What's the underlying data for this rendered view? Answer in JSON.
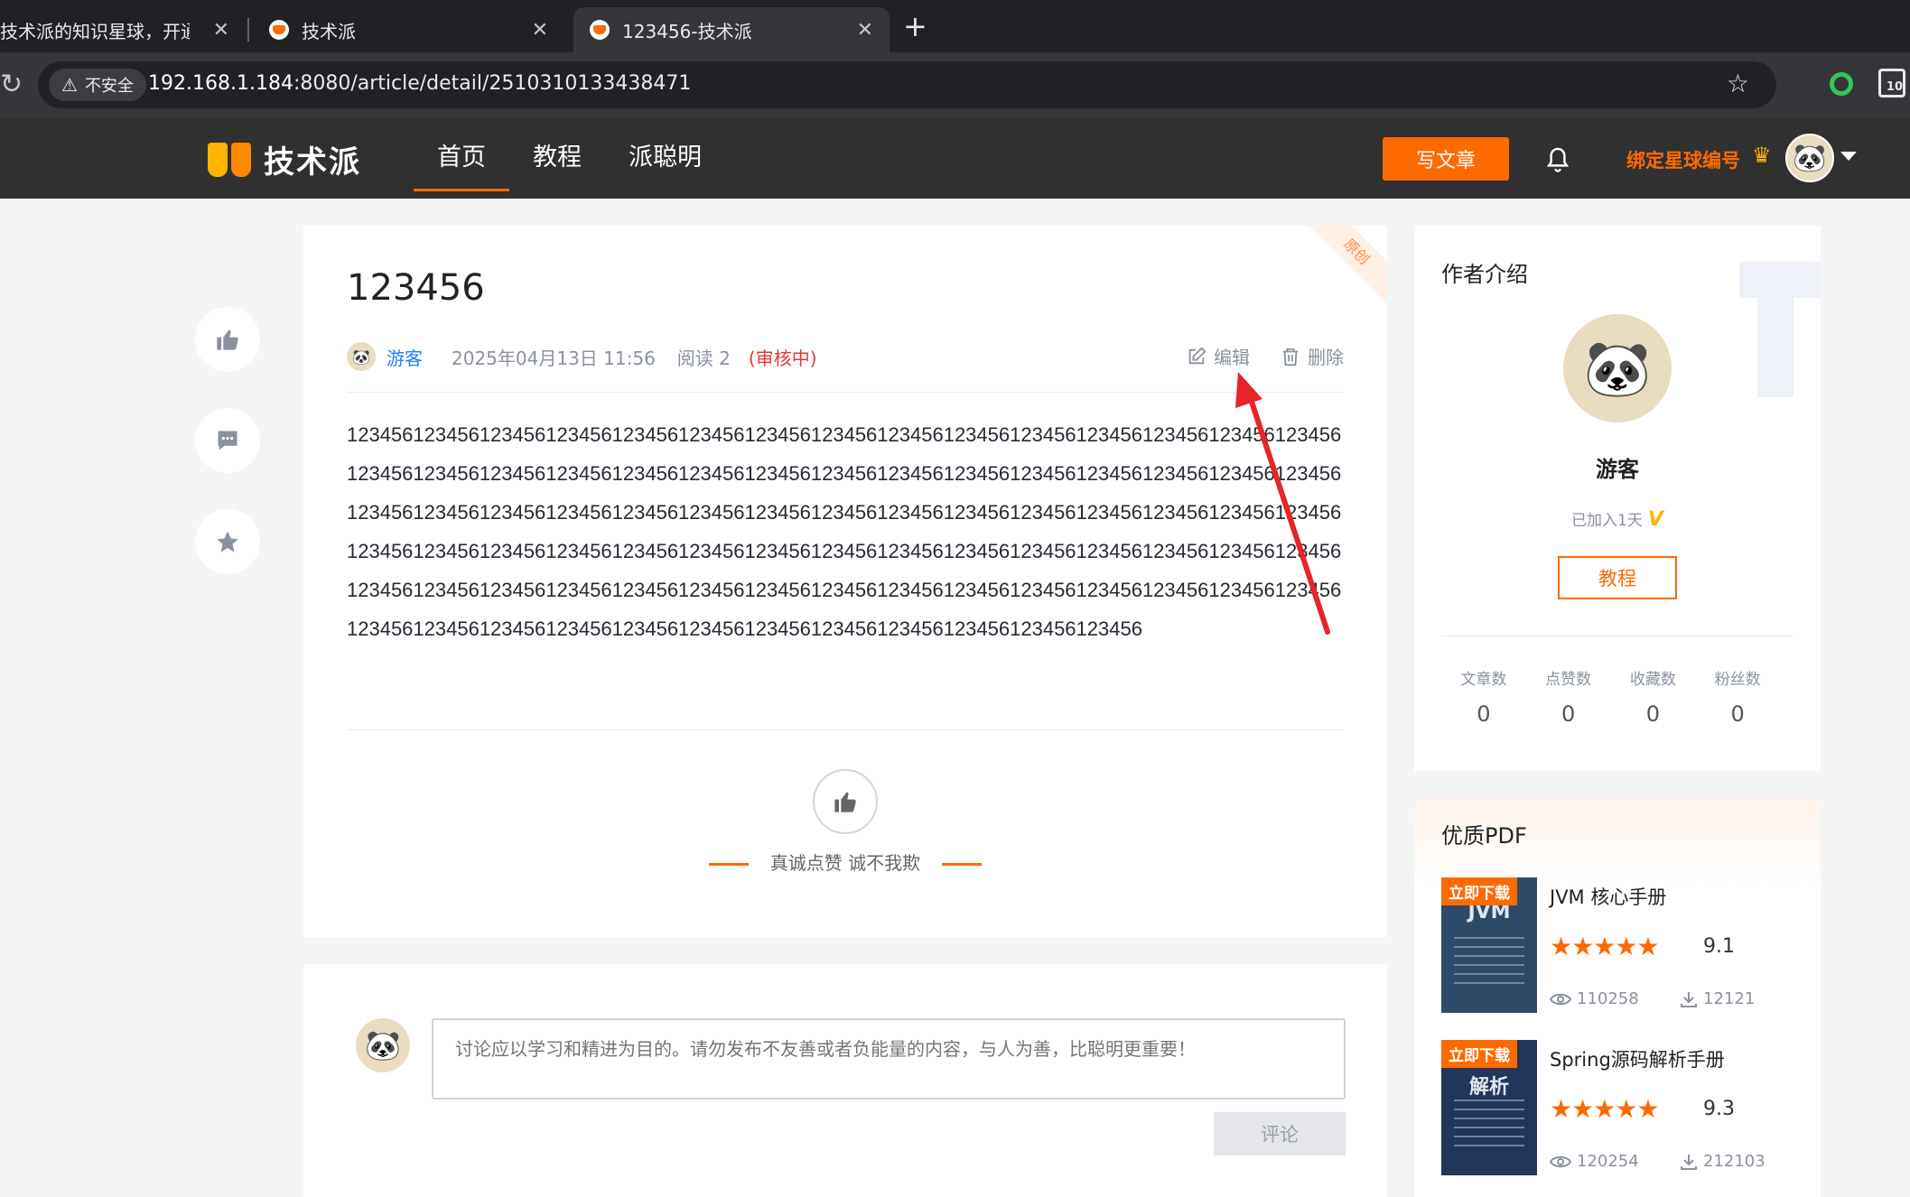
{
  "browser": {
    "tabs": [
      {
        "title": "技术派的知识星球，开通啦！附"
      },
      {
        "title": "技术派"
      },
      {
        "title": "123456-技术派"
      }
    ],
    "security_label": "不安全",
    "url_host": "192.168.1.184",
    "url_rest": ":8080/article/detail/2510310133438471",
    "ext_badge": "10"
  },
  "site": {
    "logo_text": "技术派",
    "nav": [
      "首页",
      "教程",
      "派聪明"
    ],
    "write_button": "写文章",
    "bind_label": "绑定星球编号"
  },
  "article": {
    "ribbon": "原创",
    "title": "123456",
    "author": "游客",
    "date": "2025年04月13日 11:56",
    "reads": "阅读 2",
    "status": "(审核中)",
    "edit_label": "编辑",
    "delete_label": "删除",
    "body": "123456123456123456123456123456123456123456123456123456123456123456123456123456123456123456123456123456123456123456123456123456123456123456123456123456123456123456123456123456123456123456123456123456123456123456123456123456123456123456123456123456123456123456123456123456123456123456123456123456123456123456123456123456123456123456123456123456123456123456123456123456123456123456123456123456123456123456123456123456123456123456123456123456123456123456123456123456123456123456123456123456123456123456123456123456123456123456",
    "like_note": "真诚点赞 诚不我欺"
  },
  "comment": {
    "placeholder": "讨论应以学习和精进为目的。请勿发布不友善或者负能量的内容，与人为善，比聪明更重要！",
    "submit": "评论"
  },
  "author_card": {
    "title": "作者介绍",
    "name": "游客",
    "joined": "已加入1天",
    "joined_badge": "V",
    "button": "教程",
    "stats": [
      {
        "label": "文章数",
        "value": "0"
      },
      {
        "label": "点赞数",
        "value": "0"
      },
      {
        "label": "收藏数",
        "value": "0"
      },
      {
        "label": "粉丝数",
        "value": "0"
      }
    ]
  },
  "pdf": {
    "title": "优质PDF",
    "items": [
      {
        "tag": "立即下载",
        "cover_title": "JVM",
        "name": "JVM 核心手册",
        "stars": "★★★★★",
        "rating": "9.1",
        "views": "110258",
        "downloads": "12121"
      },
      {
        "tag": "立即下载",
        "cover_title": "解析",
        "name": "Spring源码解析手册",
        "stars": "★★★★★",
        "rating": "9.3",
        "views": "120254",
        "downloads": "212103"
      }
    ]
  },
  "colors": {
    "brand": "#ff6a00",
    "link": "#1e80ff",
    "status": "#e53935",
    "header_bg": "#303030"
  }
}
